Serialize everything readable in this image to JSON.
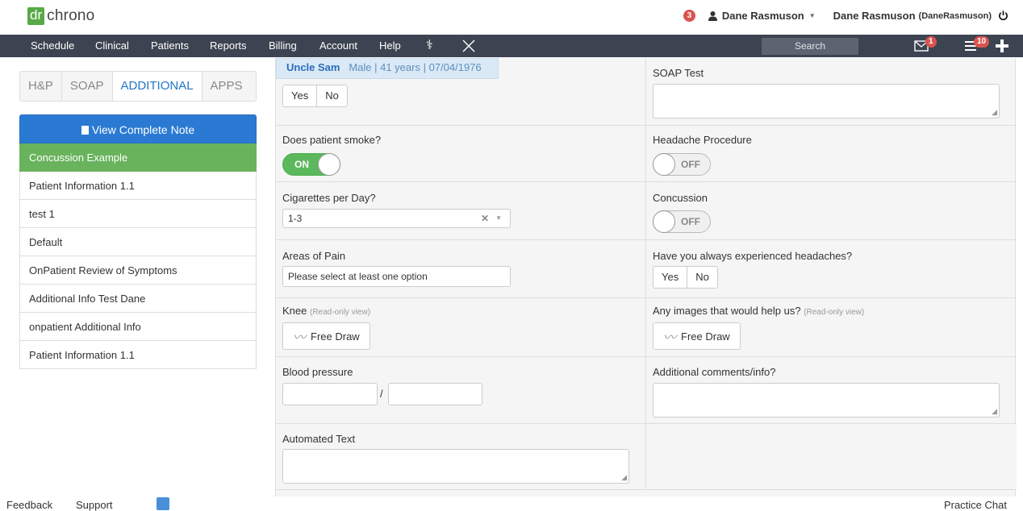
{
  "app": {
    "logo_dr": "dr",
    "logo_name": "chrono"
  },
  "topright": {
    "notif_count": "3",
    "user_menu": "Dane Rasmuson",
    "user_name": "Dane Rasmuson",
    "user_handle": "(DaneRasmuson)"
  },
  "nav": {
    "items": [
      "Schedule",
      "Clinical",
      "Patients",
      "Reports",
      "Billing",
      "Account",
      "Help"
    ],
    "search_placeholder": "Search",
    "mail_badge": "1",
    "list_badge": "10"
  },
  "sidebar": {
    "tabs": [
      "H&P",
      "SOAP",
      "ADDITIONAL",
      "APPS"
    ],
    "active_tab": "ADDITIONAL",
    "view_note": "View Complete Note",
    "items": [
      "Concussion Example",
      "Patient Information 1.1",
      "test 1",
      "Default",
      "OnPatient Review of Symptoms",
      "Additional Info Test Dane",
      "onpatient Additional Info",
      "Patient Information 1.1"
    ]
  },
  "patient": {
    "name": "Uncle Sam",
    "details": "Male | 41 years | 07/04/1976"
  },
  "form": {
    "yes": "Yes",
    "no": "No",
    "soap_test": "SOAP Test",
    "smoke_label": "Does patient smoke?",
    "smoke_toggle": "ON",
    "headache_proc": "Headache Procedure",
    "off": "OFF",
    "cigs_label": "Cigarettes per Day?",
    "cigs_value": "1-3",
    "concussion": "Concussion",
    "pain_label": "Areas of Pain",
    "pain_placeholder": "Please select at least one option",
    "headaches_label": "Have you always experienced headaches?",
    "knee_label": "Knee",
    "readonly": "(Read-only view)",
    "free_draw": "Free Draw",
    "images_label": "Any images that would help us?",
    "bp_label": "Blood pressure",
    "bp_sep": "/",
    "comments_label": "Additional comments/info?",
    "auto_label": "Automated Text"
  },
  "footer": {
    "feedback": "Feedback",
    "support": "Support",
    "chat": "Practice Chat"
  }
}
